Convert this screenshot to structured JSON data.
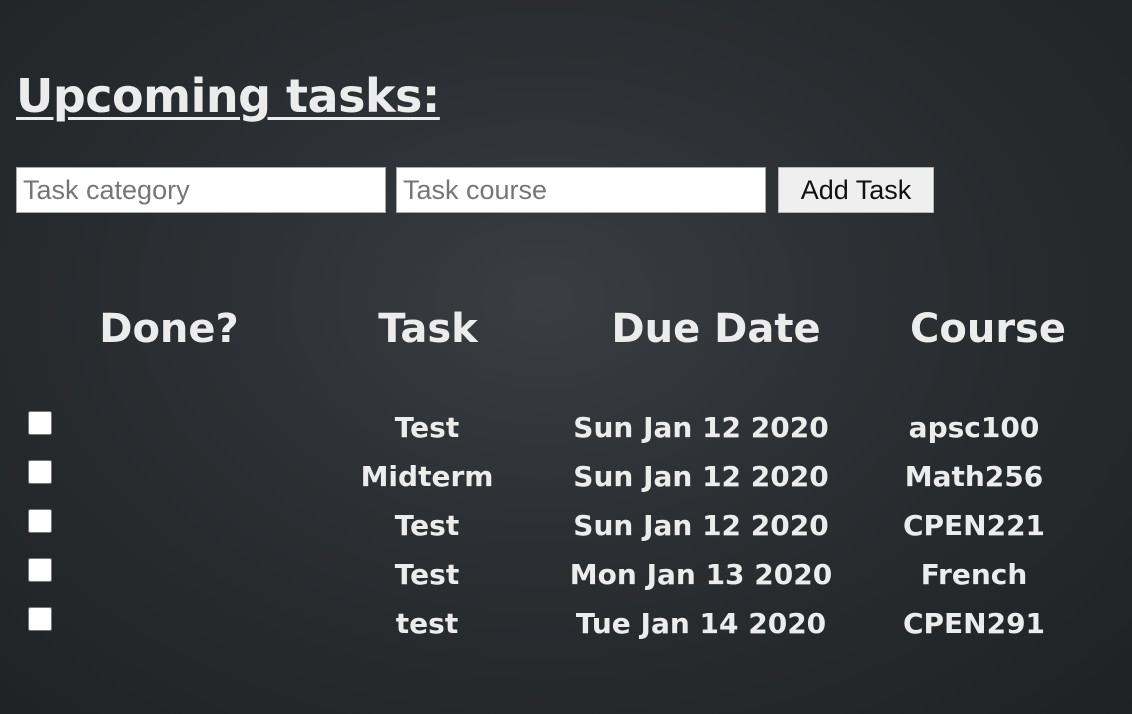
{
  "page": {
    "title": "Upcoming tasks:"
  },
  "form": {
    "category_placeholder": "Task category",
    "category_value": "",
    "course_placeholder": "Task course",
    "course_value": "",
    "add_label": "Add Task"
  },
  "table": {
    "headers": {
      "done": "Done?",
      "task": "Task",
      "due": "Due Date",
      "course": "Course"
    },
    "rows": [
      {
        "done": false,
        "task": "Test",
        "due": "Sun Jan 12 2020",
        "course": "apsc100"
      },
      {
        "done": false,
        "task": "Midterm",
        "due": "Sun Jan 12 2020",
        "course": "Math256"
      },
      {
        "done": false,
        "task": "Test",
        "due": "Sun Jan 12 2020",
        "course": "CPEN221"
      },
      {
        "done": false,
        "task": "Test",
        "due": "Mon Jan 13 2020",
        "course": "French"
      },
      {
        "done": false,
        "task": "test",
        "due": "Tue Jan 14 2020",
        "course": "CPEN291"
      }
    ]
  },
  "colors": {
    "background": "#2c2f33",
    "text": "#ececec"
  }
}
